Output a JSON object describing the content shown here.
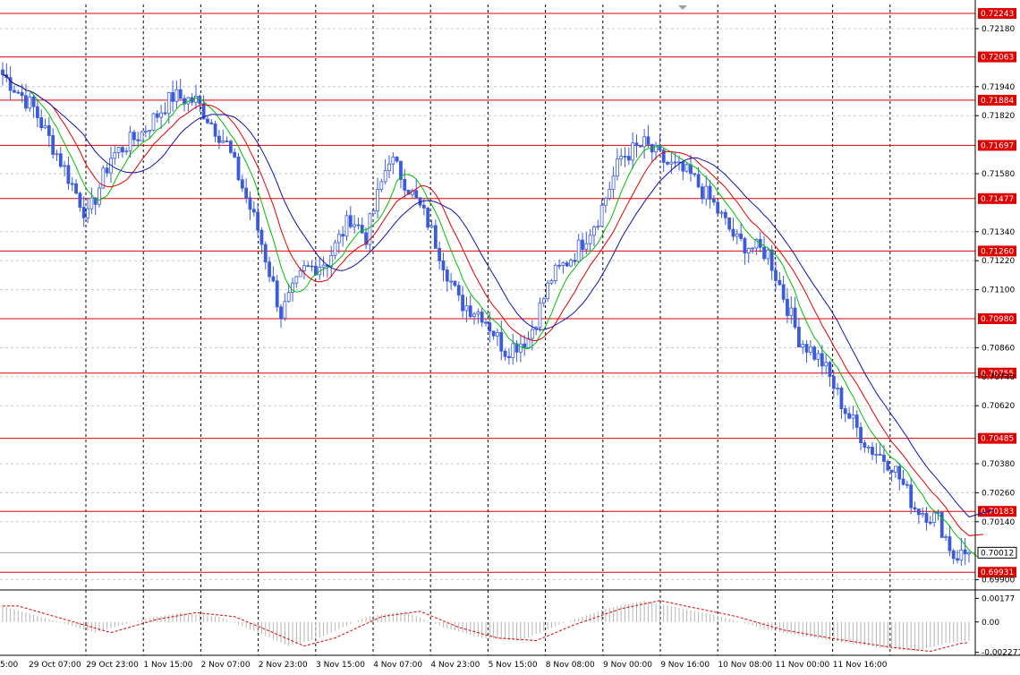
{
  "chart_data": {
    "type": "candlestick",
    "y_ticks": [
      "0.72180",
      "0.71940",
      "0.71820",
      "0.71580",
      "0.71340",
      "0.71220",
      "0.71100",
      "0.70860",
      "0.70740",
      "0.70620",
      "0.70380",
      "0.70260",
      "0.70140",
      "0.69900"
    ],
    "x_ticks": [
      "5:00",
      "29 Oct 07:00",
      "29 Oct 23:00",
      "1 Nov 15:00",
      "2 Nov 07:00",
      "2 Nov 23:00",
      "3 Nov 15:00",
      "4 Nov 07:00",
      "4 Nov 23:00",
      "5 Nov 15:00",
      "8 Nov 08:00",
      "9 Nov 00:00",
      "9 Nov 16:00",
      "10 Nov 08:00",
      "11 Nov 00:00",
      "11 Nov 16:00"
    ],
    "levels": [
      {
        "label": "0.72243",
        "value": 0.72243
      },
      {
        "label": "0.72063",
        "value": 0.72063
      },
      {
        "label": "0.71884",
        "value": 0.71884
      },
      {
        "label": "0.71697",
        "value": 0.71697
      },
      {
        "label": "0.71477",
        "value": 0.71477
      },
      {
        "label": "0.71260",
        "value": 0.7126
      },
      {
        "label": "0.70980",
        "value": 0.7098
      },
      {
        "label": "0.70755",
        "value": 0.70755
      },
      {
        "label": "0.70485",
        "value": 0.70485
      },
      {
        "label": "0.70183",
        "value": 0.70183
      },
      {
        "label": "0.69931",
        "value": 0.69931
      }
    ],
    "current_price": {
      "label": "0.70012",
      "value": 0.70012
    },
    "ylim": [
      0.6988,
      0.7228
    ],
    "price_waypoints": [
      [
        0,
        0.7199
      ],
      [
        8,
        0.7185
      ],
      [
        16,
        0.716
      ],
      [
        22,
        0.714
      ],
      [
        28,
        0.7165
      ],
      [
        36,
        0.7175
      ],
      [
        44,
        0.719
      ],
      [
        50,
        0.7188
      ],
      [
        58,
        0.717
      ],
      [
        66,
        0.7135
      ],
      [
        72,
        0.71
      ],
      [
        78,
        0.7118
      ],
      [
        84,
        0.7122
      ],
      [
        90,
        0.714
      ],
      [
        94,
        0.7132
      ],
      [
        100,
        0.7165
      ],
      [
        104,
        0.7155
      ],
      [
        110,
        0.7138
      ],
      [
        118,
        0.7105
      ],
      [
        124,
        0.71
      ],
      [
        130,
        0.7085
      ],
      [
        136,
        0.709
      ],
      [
        142,
        0.7115
      ],
      [
        148,
        0.7125
      ],
      [
        154,
        0.714
      ],
      [
        160,
        0.7165
      ],
      [
        166,
        0.717
      ],
      [
        172,
        0.7162
      ],
      [
        178,
        0.7157
      ],
      [
        184,
        0.7145
      ],
      [
        190,
        0.713
      ],
      [
        198,
        0.7125
      ],
      [
        206,
        0.709
      ],
      [
        212,
        0.708
      ],
      [
        218,
        0.706
      ],
      [
        224,
        0.7045
      ],
      [
        230,
        0.7038
      ],
      [
        236,
        0.702
      ],
      [
        242,
        0.7015
      ],
      [
        246,
        0.7
      ],
      [
        250,
        0.7001
      ]
    ],
    "oscillator": {
      "y_ticks": [
        "0.00177",
        "0.00",
        "-0.002277"
      ],
      "ylim": [
        -0.0025,
        0.0022
      ],
      "waypoints": [
        [
          0,
          0.0012
        ],
        [
          12,
          0.0002
        ],
        [
          24,
          -0.0008
        ],
        [
          36,
          0.0002
        ],
        [
          46,
          0.0007
        ],
        [
          56,
          0.0004
        ],
        [
          66,
          -0.0008
        ],
        [
          74,
          -0.0018
        ],
        [
          82,
          -0.0012
        ],
        [
          94,
          0.0004
        ],
        [
          104,
          0.0008
        ],
        [
          114,
          -0.0004
        ],
        [
          124,
          -0.0012
        ],
        [
          134,
          -0.0014
        ],
        [
          144,
          -0.0002
        ],
        [
          156,
          0.001
        ],
        [
          166,
          0.0016
        ],
        [
          176,
          0.001
        ],
        [
          186,
          0.0004
        ],
        [
          198,
          -0.0006
        ],
        [
          212,
          -0.0013
        ],
        [
          226,
          -0.0019
        ],
        [
          236,
          -0.0022
        ],
        [
          244,
          -0.0016
        ],
        [
          250,
          -0.0014
        ]
      ]
    }
  }
}
